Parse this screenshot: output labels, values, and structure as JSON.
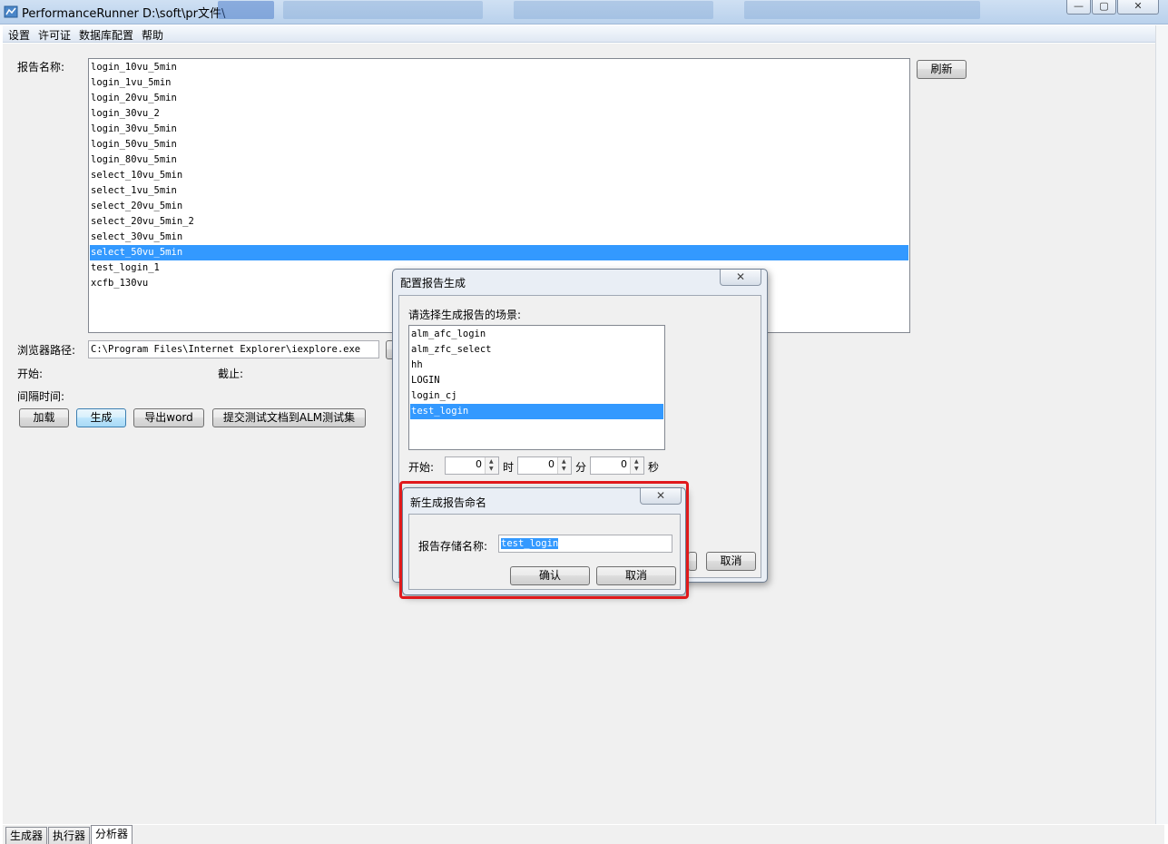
{
  "window": {
    "title": "PerformanceRunner  D:\\soft\\pr文件\\",
    "controls": {
      "minimize": "—",
      "maximize": "▢",
      "close": "✕"
    }
  },
  "menu": [
    "设置",
    "许可证",
    "数据库配置",
    "帮助"
  ],
  "main": {
    "report_name_label": "报告名称:",
    "refresh_button": "刷新",
    "reports": [
      "login_10vu_5min",
      "login_1vu_5min",
      "login_20vu_5min",
      "login_30vu_2",
      "login_30vu_5min",
      "login_50vu_5min",
      "login_80vu_5min",
      "select_10vu_5min",
      "select_1vu_5min",
      "select_20vu_5min",
      "select_20vu_5min_2",
      "select_30vu_5min",
      "select_50vu_5min",
      "test_login_1",
      "xcfb_130vu"
    ],
    "selected_report": "select_50vu_5min",
    "browser_path_label": "浏览器路径:",
    "browser_path_value": "C:\\Program Files\\Internet Explorer\\iexplore.exe",
    "start_label": "开始:",
    "end_label": "截止:",
    "interval_label": "间隔时间:",
    "load_button": "加载",
    "generate_button": "生成",
    "export_word_button": "导出word",
    "submit_alm_button": "提交测试文档到ALM测试集"
  },
  "config_dialog": {
    "title": "配置报告生成",
    "scene_label": "请选择生成报告的场景:",
    "scenes": [
      "alm_afc_login",
      "alm_zfc_select",
      "hh",
      "LOGIN",
      "login_cj",
      "test_login"
    ],
    "selected_scene": "test_login",
    "start_label": "开始:",
    "hour_value": "0",
    "hour_unit": "时",
    "minute_value": "0",
    "minute_unit": "分",
    "second_value": "0",
    "second_unit": "秒",
    "cancel_button": "取消",
    "close": "✕"
  },
  "name_dialog": {
    "title": "新生成报告命名",
    "field_label": "报告存储名称:",
    "field_value": "test_login",
    "confirm_button": "确认",
    "cancel_button": "取消",
    "close": "✕"
  },
  "tabs": [
    "生成器",
    "执行器",
    "分析器"
  ],
  "active_tab": "分析器",
  "colors": {
    "selection": "#3399ff",
    "highlight_box": "#e0191c"
  }
}
